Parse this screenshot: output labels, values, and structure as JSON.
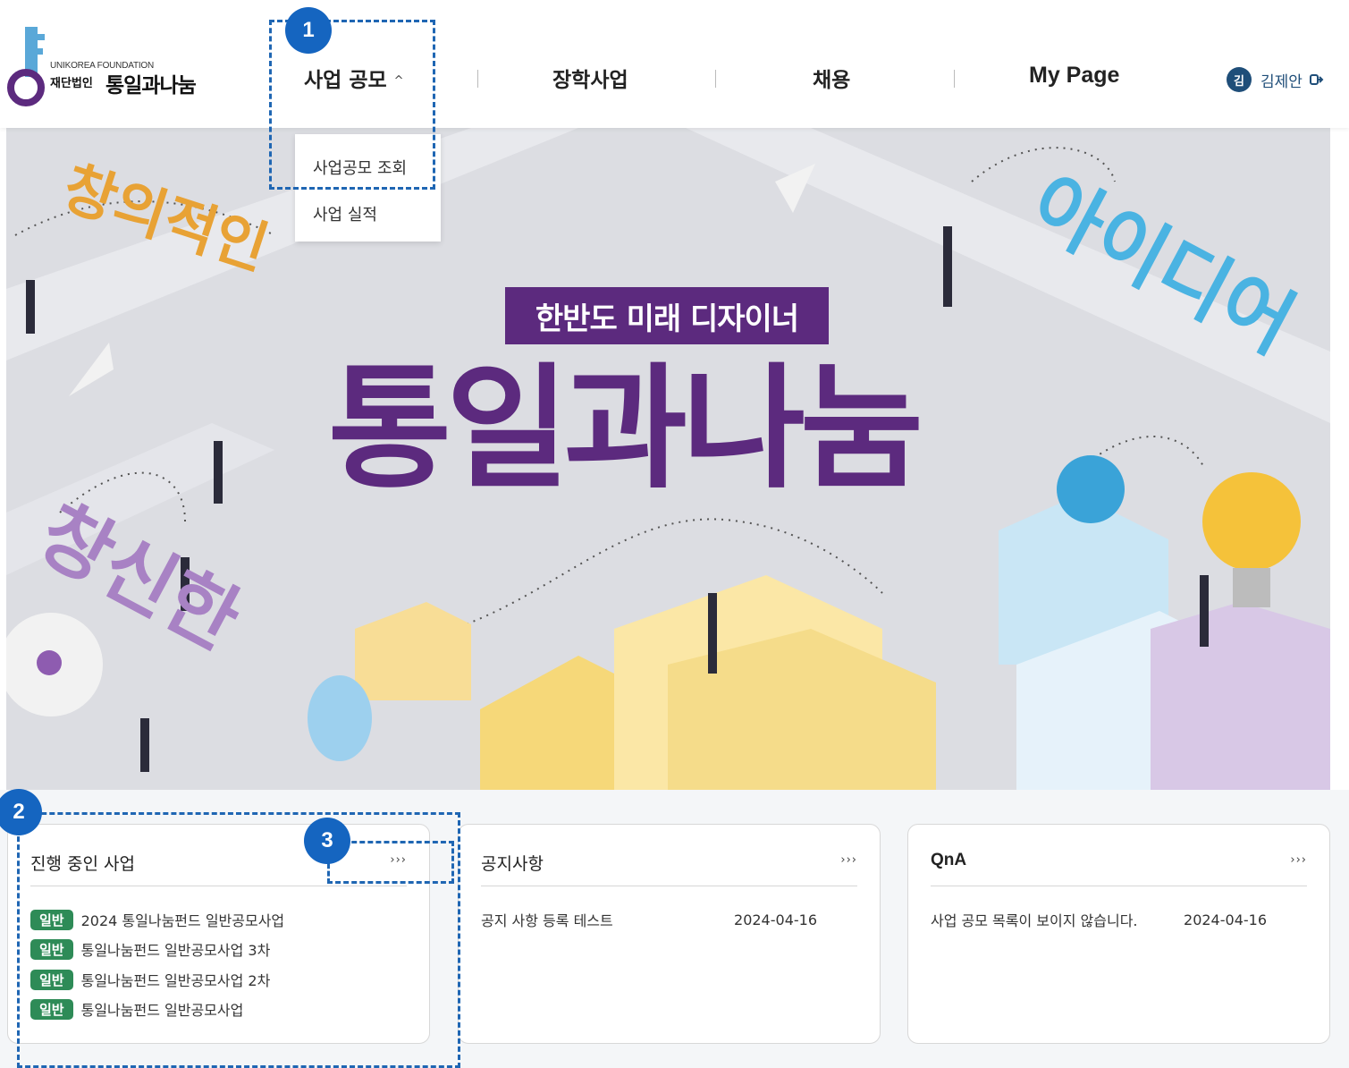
{
  "header": {
    "logo_sub": "UNIKOREA FOUNDATION",
    "logo_small": "재단법인",
    "logo_main": "통일과나눔",
    "nav": [
      {
        "label": "사업 공모",
        "chevron": "^"
      },
      {
        "label": "장학사업"
      },
      {
        "label": "채용"
      },
      {
        "label": "My Page"
      }
    ],
    "user": {
      "avatar": "김",
      "name": "김제안",
      "logout_icon": "logout-icon"
    }
  },
  "dropdown": {
    "items": [
      "사업공모 조회",
      "사업 실적"
    ]
  },
  "hero": {
    "subtitle": "한반도 미래 디자이너",
    "title": "통일과나눔",
    "words": [
      "창의적인",
      "창신한",
      "아이디어"
    ]
  },
  "panels": {
    "ongoing": {
      "title": "진행 중인 사업",
      "more": "›››",
      "items": [
        {
          "badge": "일반",
          "text": "2024 통일나눔펀드 일반공모사업"
        },
        {
          "badge": "일반",
          "text": "통일나눔펀드 일반공모사업 3차"
        },
        {
          "badge": "일반",
          "text": "통일나눔펀드 일반공모사업 2차"
        },
        {
          "badge": "일반",
          "text": "통일나눔펀드 일반공모사업"
        }
      ]
    },
    "notice": {
      "title": "공지사항",
      "more": "›››",
      "items": [
        {
          "text": "공지 사항 등록 테스트",
          "date": "2024-04-16"
        }
      ]
    },
    "qna": {
      "title": "QnA",
      "more": "›››",
      "items": [
        {
          "text": "사업 공모 목록이 보이지 않습니다.",
          "date": "2024-04-16"
        }
      ]
    }
  },
  "callouts": [
    "1",
    "2",
    "3"
  ],
  "colors": {
    "brand_purple": "#5c2a7e",
    "badge_green": "#2e8b57",
    "callout_blue": "#1565c0",
    "user_blue": "#1f4e79"
  }
}
